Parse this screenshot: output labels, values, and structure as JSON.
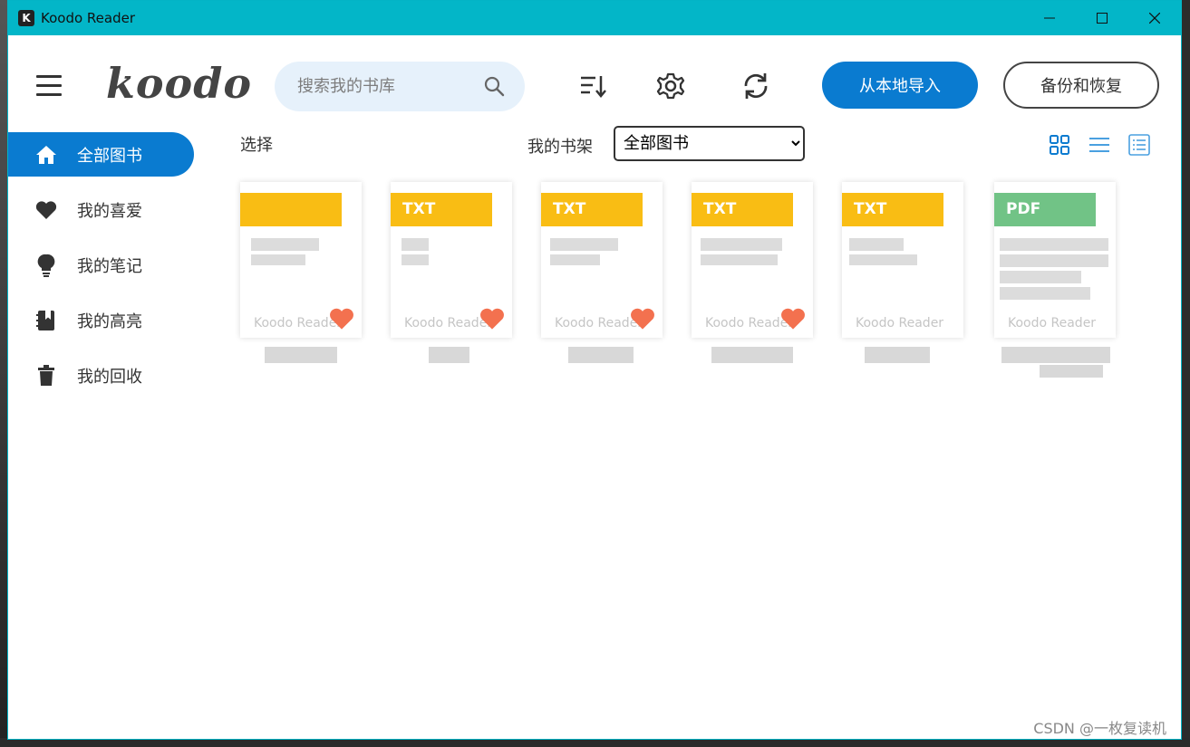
{
  "window": {
    "title": "Koodo Reader"
  },
  "header": {
    "logo": "koodo",
    "search_placeholder": "搜索我的书库",
    "import_label": "从本地导入",
    "backup_label": "备份和恢复"
  },
  "sidebar": {
    "items": [
      {
        "label": "全部图书",
        "icon": "home-icon",
        "active": true
      },
      {
        "label": "我的喜爱",
        "icon": "heart-icon",
        "active": false
      },
      {
        "label": "我的笔记",
        "icon": "bulb-icon",
        "active": false
      },
      {
        "label": "我的高亮",
        "icon": "bookmark-icon",
        "active": false
      },
      {
        "label": "我的回收",
        "icon": "trash-icon",
        "active": false
      }
    ]
  },
  "toolbar": {
    "select_label": "选择",
    "shelf_label": "我的书架",
    "shelf_value": "全部图书"
  },
  "books": [
    {
      "format": "",
      "brand": "Koodo Reader",
      "favorite": true
    },
    {
      "format": "TXT",
      "brand": "Koodo Reader",
      "favorite": true
    },
    {
      "format": "TXT",
      "brand": "Koodo Reader",
      "favorite": true
    },
    {
      "format": "TXT",
      "brand": "Koodo Reader",
      "favorite": true
    },
    {
      "format": "TXT",
      "brand": "Koodo Reader",
      "favorite": false
    },
    {
      "format": "PDF",
      "brand": "Koodo Reader",
      "favorite": false
    }
  ],
  "colors": {
    "accent": "#0a7bd0",
    "titlebar": "#03b6c8",
    "txt_badge": "#f9bd14",
    "pdf_badge": "#71c386",
    "heart": "#f3714f"
  },
  "watermark": "CSDN @一枚复读机"
}
